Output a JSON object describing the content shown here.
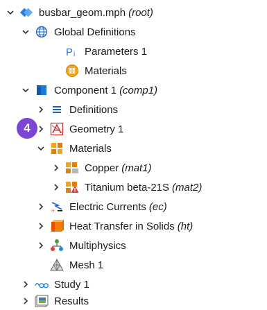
{
  "root": {
    "label": "busbar_geom.mph",
    "tag": "(root)"
  },
  "global_definitions": {
    "label": "Global Definitions"
  },
  "parameters": {
    "label": "Parameters 1",
    "icon_text": "P|"
  },
  "global_materials": {
    "label": "Materials"
  },
  "component": {
    "label": "Component 1",
    "tag": "(comp1)"
  },
  "definitions": {
    "label": "Definitions"
  },
  "geometry": {
    "label": "Geometry 1"
  },
  "materials": {
    "label": "Materials"
  },
  "copper": {
    "label": "Copper",
    "tag": "(mat1)"
  },
  "titanium": {
    "label": "Titanium beta-21S",
    "tag": "(mat2)"
  },
  "electric_currents": {
    "label": "Electric Currents",
    "tag": "(ec)"
  },
  "heat_transfer": {
    "label": "Heat Transfer in Solids",
    "tag": "(ht)"
  },
  "multiphysics": {
    "label": "Multiphysics"
  },
  "mesh": {
    "label": "Mesh 1"
  },
  "study": {
    "label": "Study 1"
  },
  "results": {
    "label": "Results"
  },
  "step_badge": {
    "number": "4",
    "color": "#7b46d6"
  }
}
